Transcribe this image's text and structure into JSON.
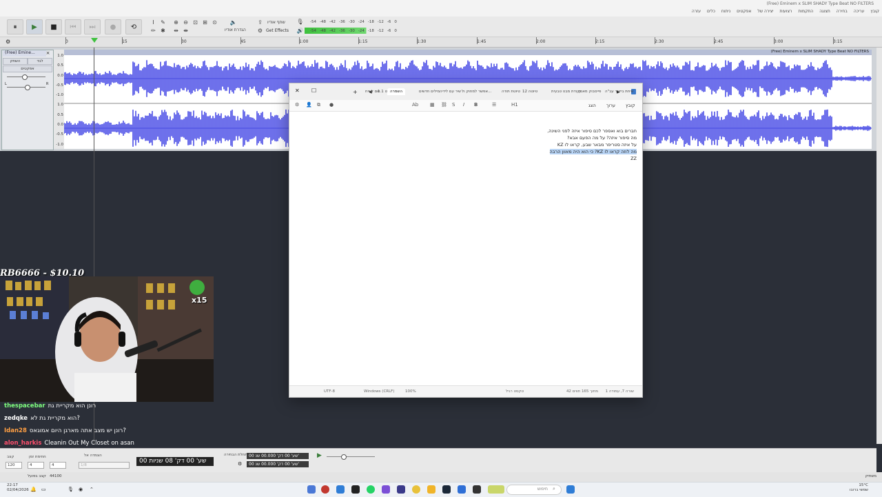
{
  "window_title": "(Free) Eminem x SLIM SHADY Type Beat  NO FILTERS",
  "menu": [
    "קובץ",
    "עריכה",
    "בחירה",
    "תצוגה",
    "התקמות",
    "רצועות",
    "יצירה של",
    "אפקטים",
    "ניתוח",
    "כלים",
    "עזרה"
  ],
  "toolbar": {
    "pause": "⏸",
    "play": "▶",
    "stop": "■",
    "skip_start": "⏮",
    "skip_end": "⏭",
    "record": "●",
    "loop": "⟲",
    "share_audio": "שתף אודיו",
    "audio_setup": "הגדרת אודיו",
    "get_effects": "Get Effects",
    "meter_ticks": [
      "-54",
      "-48",
      "-42",
      "-36",
      "-30",
      "-24",
      "-18",
      "-12",
      "-6",
      "0"
    ]
  },
  "ruler_ticks": [
    "0",
    "15",
    "30",
    "45",
    "1:00",
    "1:15",
    "1:30",
    "1:45",
    "2:00",
    "2:15",
    "2:30",
    "2:45",
    "3:00",
    "3:15"
  ],
  "track": {
    "name": "(Free) Emine...",
    "solo": "לבד",
    "mute": "השתק",
    "effects": "אפקטים",
    "clip_title": "(Free) Eminem x SLIM SHADY Type Beat  NO FILTERS",
    "scale": [
      "1.0",
      "0.5",
      "0.0",
      "-0.5",
      "-1.0",
      "1.0",
      "0.5",
      "0.0",
      "-0.5",
      "-1.0"
    ]
  },
  "notepad": {
    "tabs": [
      "טיוטת תודה",
      "טיוטה 12",
      "נקודת מבט טבעית",
      "פייסבוק מאמן",
      "שיחת ביקור עב\"ה",
      "אפשר למחוק ול...",
      "שיר עם לידיה",
      "מילים חדשים",
      "הגדר",
      "טיוט 1.1",
      "שם לשיח"
    ],
    "active_tab": "השמרה",
    "menu": [
      "קובץ",
      "ערוך",
      "הצג"
    ],
    "heading_label": "H1",
    "lines": [
      "חברים בוא ואספר לכם סיפור איזה לפני השינה,",
      "מה סיפור איזה? על מה הפעם אבא?",
      "על איזה סטריפר מבאר שבע, קראו לו KZ",
      "מה לוזה קראו לו KZ? כי הוא היה מאוון הרבה",
      "ZZ"
    ],
    "status": {
      "position": "שורה 7, עמודה 1",
      "chars": "42 מתוך 165 תווים",
      "type": "טקסט רגיל",
      "zoom": "100%",
      "eol": "Windows (CRLF)",
      "encoding": "UTF-8"
    }
  },
  "donation": "RB6666 - $10.10",
  "webcam_badge": "x15",
  "chat": [
    {
      "user": "thespacebar",
      "color": "#7fff7f",
      "text": "רונן הוא מקריית גת"
    },
    {
      "user": "zedqke",
      "color": "#ffffff",
      "text": "הוא מקריית גת לא?"
    },
    {
      "user": "Idan28",
      "color": "#ff9f43",
      "text": "רונן יש מצב אתה מארגן היום אמוגאס?"
    },
    {
      "user": "alon_harkis",
      "color": "#ff4f6d",
      "text": "Cleanin Out My Closet on asan"
    }
  ],
  "selection_bar": {
    "rate_label": "קצב",
    "rate_value": "120",
    "time_sig_label": "חתימת זמן",
    "time_sig_a": "4",
    "time_sig_b": "4",
    "snap_label": "הצמדה אל",
    "snap_value": "1/8",
    "big_time": "00 שע' 00 דק' 08 שניות",
    "start_label": "התחלת הבחירה",
    "start_value": "00 שע' 00 דק' 00.000 שנ'",
    "end_value": "00 שע' 00 דק' 00.000 שנ'"
  },
  "status_left": "44100",
  "status_left_label": "קצב בפועל",
  "status_right": "משתיק",
  "clock": {
    "time": "22:17",
    "date": "02/04/2026"
  },
  "weather": "15°C",
  "weather_desc": "שמשי ברובו",
  "search_placeholder": "חיפוש",
  "colors": {
    "waveform": "#4a4de6",
    "selection": "#b8d4f5",
    "accent_green": "#3ec13e"
  }
}
